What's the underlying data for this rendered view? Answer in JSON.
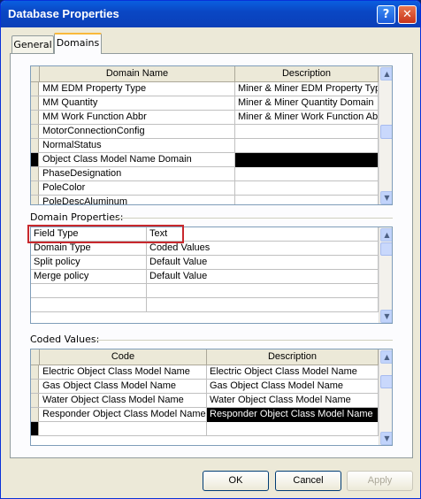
{
  "window": {
    "title": "Database Properties",
    "help_glyph": "?",
    "close_glyph": "✕"
  },
  "tabs": [
    {
      "label": "General"
    },
    {
      "label": "Domains"
    }
  ],
  "domains": {
    "headers": {
      "name": "Domain Name",
      "description": "Description"
    },
    "rows": [
      {
        "name": "MM EDM Property Type",
        "description": "Miner & Miner EDM Property Type"
      },
      {
        "name": "MM Quantity",
        "description": "Miner & Miner Quantity Domain"
      },
      {
        "name": "MM Work Function Abbr",
        "description": "Miner & Miner Work Function Abbreviation"
      },
      {
        "name": "MotorConnectionConfig",
        "description": ""
      },
      {
        "name": "NormalStatus",
        "description": ""
      },
      {
        "name": "Object Class Model Name Domain",
        "description": ""
      },
      {
        "name": "PhaseDesignation",
        "description": ""
      },
      {
        "name": "PoleColor",
        "description": ""
      },
      {
        "name": "PoleDescAluminum",
        "description": ""
      }
    ]
  },
  "domain_properties": {
    "label": "Domain Properties:",
    "rows": [
      {
        "property": "Field Type",
        "value": "Text"
      },
      {
        "property": "Domain Type",
        "value": "Coded Values"
      },
      {
        "property": "Split policy",
        "value": "Default Value"
      },
      {
        "property": "Merge policy",
        "value": "Default Value"
      },
      {
        "property": "",
        "value": ""
      },
      {
        "property": "",
        "value": ""
      }
    ]
  },
  "coded_values": {
    "label": "Coded Values:",
    "headers": {
      "code": "Code",
      "description": "Description"
    },
    "rows": [
      {
        "code": "Electric Object Class Model Name",
        "description": "Electric Object Class Model Name"
      },
      {
        "code": "Gas Object Class Model Name",
        "description": "Gas Object Class Model Name"
      },
      {
        "code": "Water Object Class Model Name",
        "description": "Water Object Class Model Name"
      },
      {
        "code": "Responder Object Class Model Name",
        "description": "Responder Object Class Model Name"
      },
      {
        "code": "",
        "description": ""
      }
    ]
  },
  "buttons": {
    "ok": "OK",
    "cancel": "Cancel",
    "apply": "Apply"
  },
  "scroll_glyphs": {
    "up": "▲",
    "down": "▼"
  },
  "colors": {
    "title_bar": "#0a47c4",
    "highlight_box": "#c8282d",
    "selection": "#000000"
  }
}
